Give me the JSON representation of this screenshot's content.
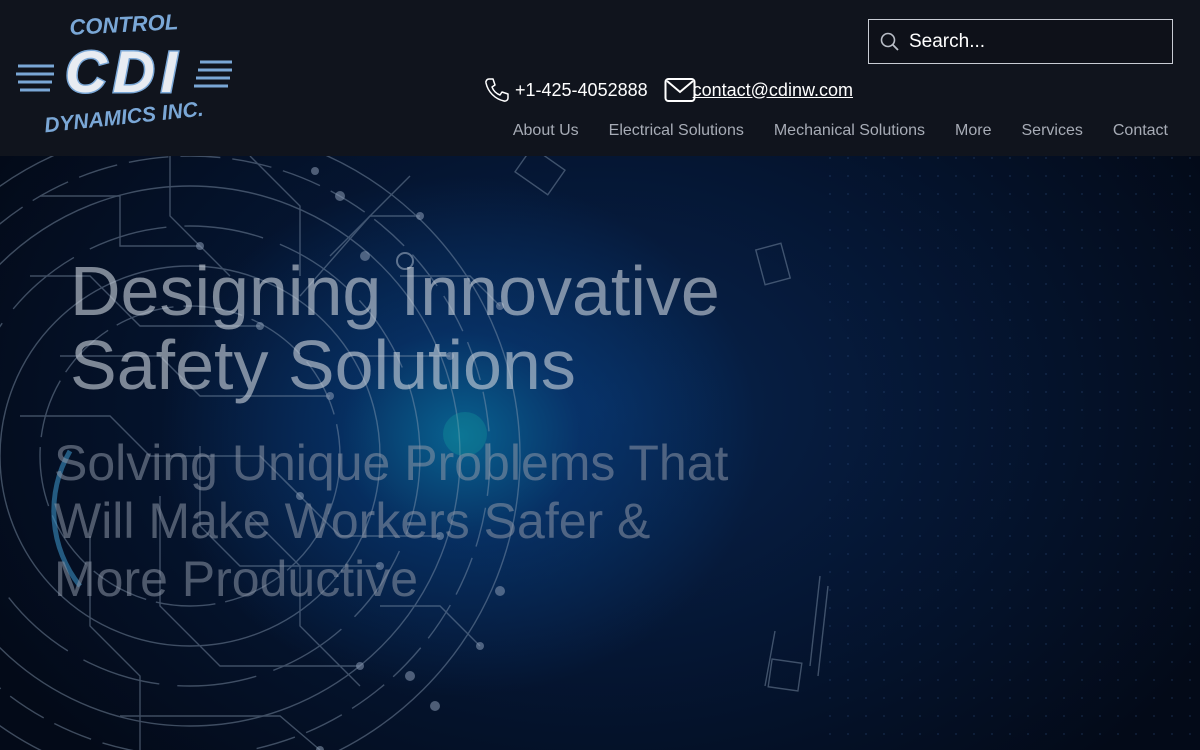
{
  "header": {
    "logo": {
      "top_text": "CONTROL",
      "main_text": "CDI",
      "bottom_text": "DYNAMICS INC.",
      "color": "#7aa7d6"
    },
    "search": {
      "placeholder": "Search...",
      "icon": "search-icon"
    },
    "phone": {
      "icon": "phone-icon",
      "text": "+1-425-4052888"
    },
    "email": {
      "icon": "mail-icon",
      "text": "contact@cdinw.com"
    },
    "nav": [
      {
        "label": "About Us"
      },
      {
        "label": "Electrical Solutions"
      },
      {
        "label": "Mechanical Solutions"
      },
      {
        "label": "More"
      },
      {
        "label": "Services"
      },
      {
        "label": "Contact"
      }
    ]
  },
  "hero": {
    "headline_line1": "Designing Innovative",
    "headline_line2": "Safety Solutions",
    "subheadline_line1": "Solving Unique Problems That",
    "subheadline_line2": "Will Make Workers Safer &",
    "subheadline_line3": "More Productive",
    "background": "circuit-board-illustration"
  },
  "colors": {
    "header_bg": "#10141d",
    "hero_bg": "#051633",
    "accent_glow": "#0a78aa",
    "nav_text": "#a7acb6"
  }
}
